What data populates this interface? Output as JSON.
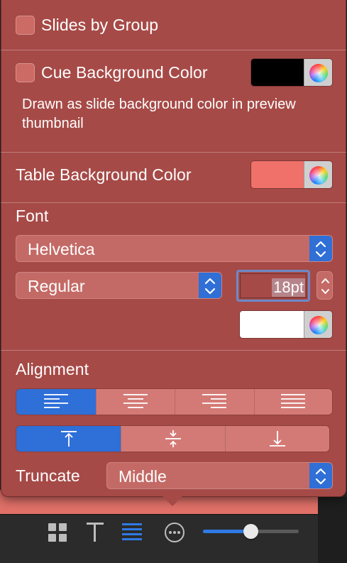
{
  "slides_by_group": {
    "label": "Slides by Group",
    "checked": false
  },
  "cue_background": {
    "label": "Cue Background Color",
    "checked": false,
    "color": "#000000",
    "note": "Drawn as slide background color in preview thumbnail"
  },
  "table_background": {
    "label": "Table Background Color",
    "color": "#f0706a"
  },
  "font": {
    "heading": "Font",
    "family": "Helvetica",
    "style": "Regular",
    "size": "18pt",
    "text_color": "#ffffff"
  },
  "alignment": {
    "heading": "Alignment",
    "horizontal": [
      "align-left",
      "align-center",
      "align-right",
      "align-justify"
    ],
    "horizontal_selected": 0,
    "vertical": [
      "align-top",
      "align-middle",
      "align-bottom"
    ],
    "vertical_selected": 0
  },
  "truncate": {
    "label": "Truncate",
    "value": "Middle"
  },
  "toolbar": {
    "icons": [
      "grid-view-icon",
      "text-view-icon",
      "list-view-icon",
      "more-options-icon"
    ],
    "selected": "list-view-icon",
    "zoom_level": 0.5
  },
  "colors": {
    "popover": "#a64a47",
    "accent": "#2e6fd8",
    "control": "#c46a66"
  }
}
